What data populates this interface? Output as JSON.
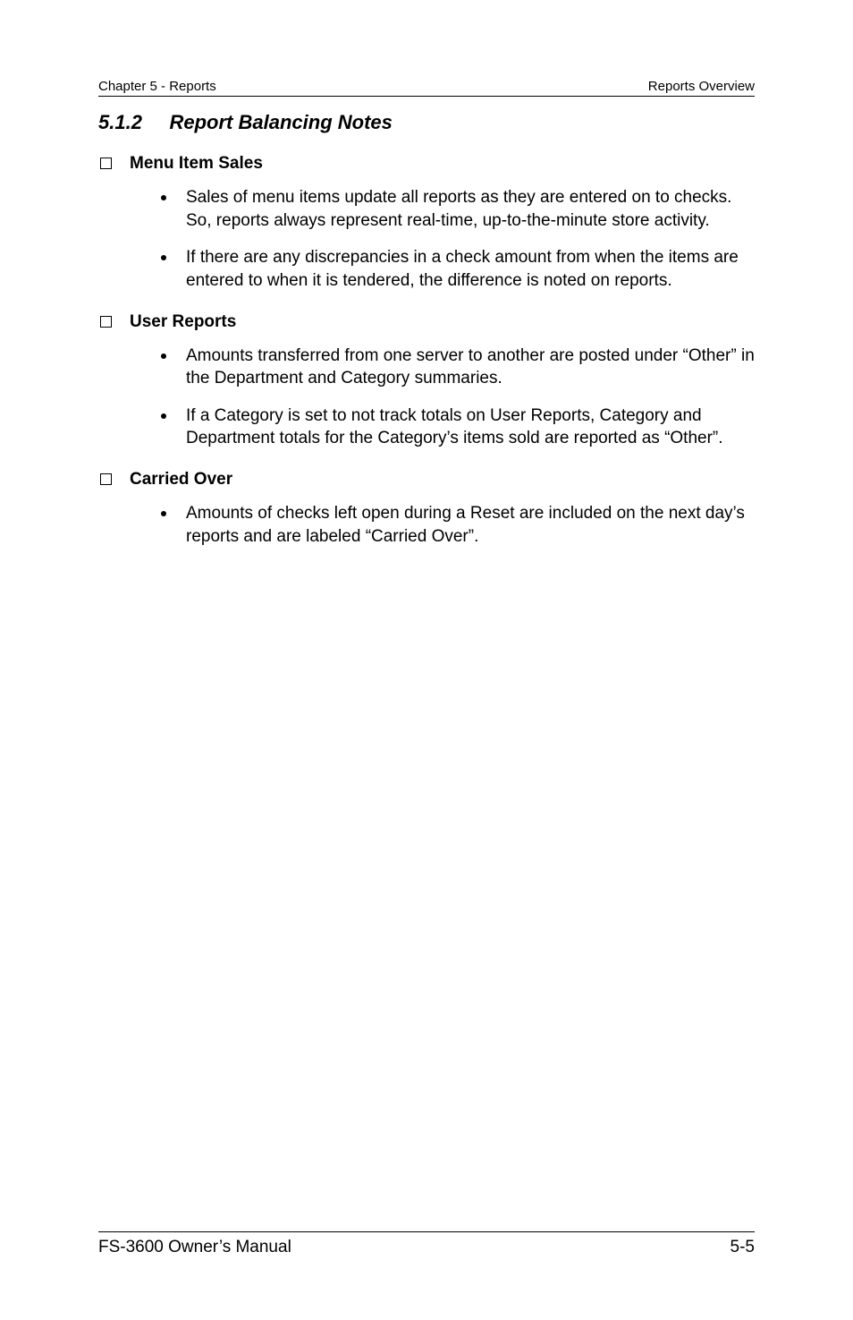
{
  "header": {
    "left": "Chapter 5 - Reports",
    "right": "Reports Overview"
  },
  "section": {
    "number": "5.1.2",
    "title": "Report Balancing Notes"
  },
  "groups": [
    {
      "heading": "Menu Item Sales",
      "bullets": [
        "Sales of menu items update all reports as they are entered on to checks.  So, reports always represent real-time, up-to-the-minute store activity.",
        "If there are any discrepancies in a check amount from when the items are entered to when it is tendered, the difference is noted on reports."
      ]
    },
    {
      "heading": "User Reports",
      "bullets": [
        "Amounts transferred from one server to another are posted under “Other” in the Department and Category summaries.",
        "If a Category is set to not track totals on User Reports, Category and Department totals for the Category’s items sold are reported as “Other”."
      ]
    },
    {
      "heading": "Carried Over",
      "bullets": [
        "Amounts of checks left open during a Reset are included on the next day’s reports and are labeled “Carried Over”."
      ]
    }
  ],
  "footer": {
    "left": "FS-3600 Owner’s Manual",
    "right": "5-5"
  }
}
